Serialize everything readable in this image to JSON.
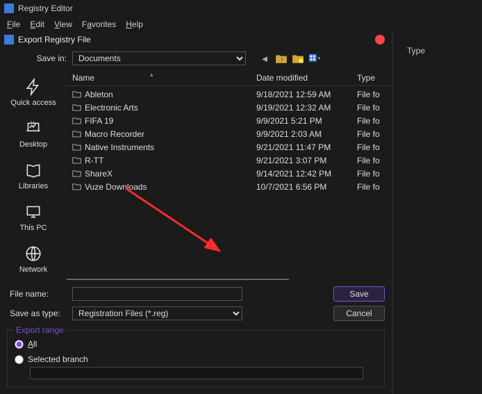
{
  "titlebar": {
    "title": "Registry Editor"
  },
  "menubar": {
    "file": "File",
    "edit": "Edit",
    "view": "View",
    "favorites": "Favorites",
    "help": "Help"
  },
  "dialog": {
    "title": "Export Registry File",
    "save_in_label": "Save in:",
    "save_in_value": "Documents",
    "columns": {
      "name": "Name",
      "date": "Date modified",
      "type": "Type"
    },
    "places": {
      "quick": "Quick access",
      "desktop": "Desktop",
      "libraries": "Libraries",
      "thispc": "This PC",
      "network": "Network"
    },
    "rows": [
      {
        "name": "Ableton",
        "date": "9/18/2021 12:59 AM",
        "type": "File fo"
      },
      {
        "name": "Electronic Arts",
        "date": "9/19/2021 12:32 AM",
        "type": "File fo"
      },
      {
        "name": "FIFA 19",
        "date": "9/9/2021 5:21 PM",
        "type": "File fo"
      },
      {
        "name": "Macro Recorder",
        "date": "9/9/2021 2:03 AM",
        "type": "File fo"
      },
      {
        "name": "Native Instruments",
        "date": "9/21/2021 11:47 PM",
        "type": "File fo"
      },
      {
        "name": "R-TT",
        "date": "9/21/2021 3:07 PM",
        "type": "File fo"
      },
      {
        "name": "ShareX",
        "date": "9/14/2021 12:42 PM",
        "type": "File fo"
      },
      {
        "name": "Vuze Downloads",
        "date": "10/7/2021 6:56 PM",
        "type": "File fo"
      }
    ],
    "file_name_label": "File name:",
    "file_name_value": "",
    "save_type_label": "Save as type:",
    "save_type_value": "Registration Files (*.reg)",
    "save_btn": "Save",
    "cancel_btn": "Cancel",
    "export_range": {
      "legend": "Export range",
      "all": "All",
      "selected": "Selected branch",
      "branch_value": ""
    }
  },
  "right_pane": {
    "type_header": "Type"
  }
}
